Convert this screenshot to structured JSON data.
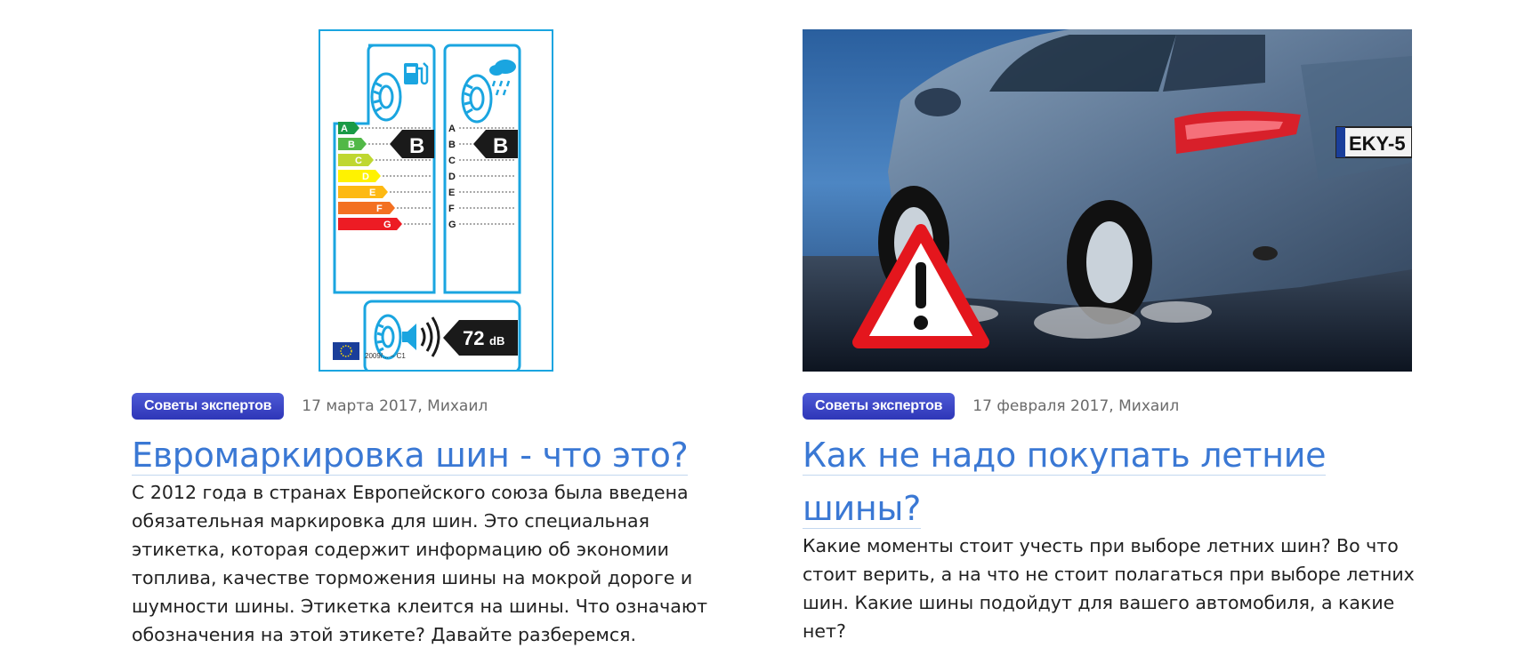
{
  "articles": [
    {
      "image": {
        "icons": [
          "fuel-pump-icon",
          "rain-cloud-icon",
          "speaker-icon",
          "eu-flag-icon"
        ],
        "fuel_grades": [
          "A",
          "B",
          "C",
          "D",
          "E",
          "F",
          "G"
        ],
        "wet_grades": [
          "A",
          "B",
          "C",
          "D",
          "E",
          "F",
          "G"
        ],
        "fuel_rating": "B",
        "wet_rating": "B",
        "noise_value": "72",
        "noise_unit": "dB",
        "regulation": "2009/... – C1",
        "colors": {
          "frame": "#1aa5e0",
          "A": "#1a9a46",
          "B": "#52b847",
          "C": "#bfd730",
          "D": "#fff200",
          "E": "#fdb913",
          "F": "#f37021",
          "G": "#ed1c24"
        }
      },
      "category": "Советы экспертов",
      "meta": "17 марта 2017, Михаил",
      "title": "Евромаркировка шин - что это?",
      "excerpt": "С 2012 года в странах Европейского союза была введена обязательная маркировка для шин. Это специальная этикетка, которая содержит информацию об экономии топлива, качестве торможения шины на мокрой дороге и шумности шины. Этикетка клеится на шины. Что означают обозначения на этой этикете? Давайте разберемся."
    },
    {
      "image": {
        "plate": "EKY-5",
        "icons": [
          "warning-triangle-icon",
          "car-rear-photo"
        ]
      },
      "category": "Советы экспертов",
      "meta": "17 февраля 2017, Михаил",
      "title": "Как не надо покупать летние шины?",
      "excerpt": "Какие моменты стоит учесть при выборе летних шин? Во что стоит верить, а на что не стоит полагаться при выборе летних шин. Какие шины подойдут для вашего автомобиля, а какие нет?"
    }
  ]
}
